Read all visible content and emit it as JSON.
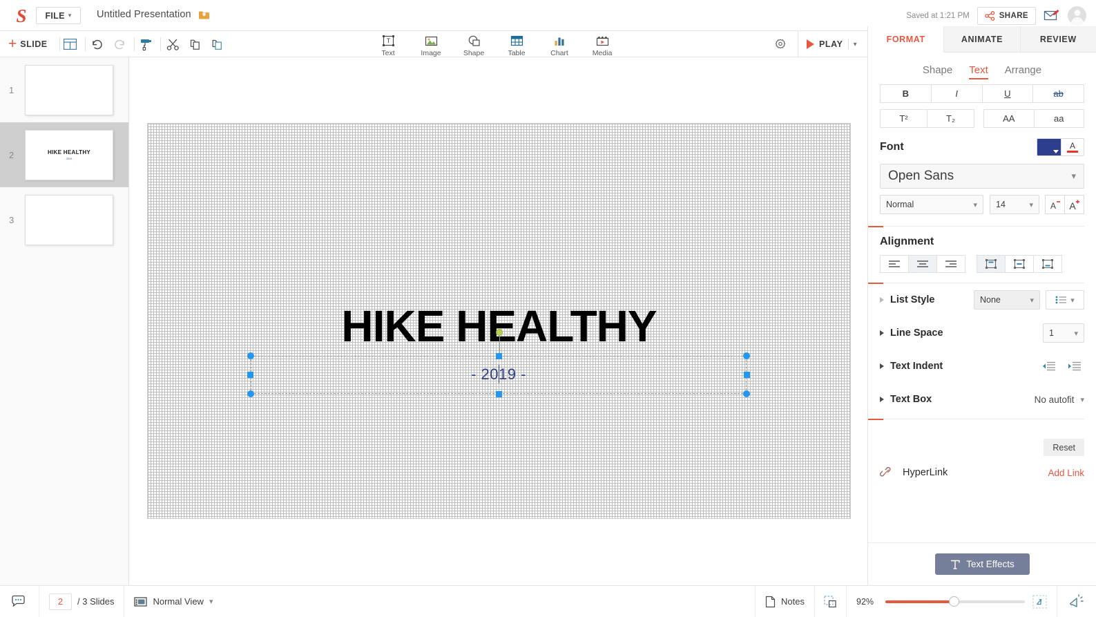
{
  "app": {
    "name": "Zoho Show",
    "logo_icon": "zoho-show-logo"
  },
  "topbar": {
    "file_menu": "FILE",
    "presentation_title": "Untitled Presentation",
    "folder_icon": "folder-move-icon",
    "saved_status": "Saved at 1:21 PM",
    "share_label": "SHARE",
    "share_icon": "share-nodes-icon",
    "mail_icon": "mail-compose-icon",
    "avatar_icon": "user-avatar"
  },
  "toolbar": {
    "add_slide": "SLIDE",
    "plus_icon": "plus-icon",
    "layout_icon": "slide-layout-icon",
    "undo_icon": "undo-icon",
    "redo_icon": "redo-icon",
    "format_painter_icon": "format-painter-icon",
    "cut_icon": "scissors-icon",
    "copy_icon": "copy-icon",
    "paste_icon": "paste-icon",
    "insert": [
      {
        "label": "Text",
        "icon": "text-box-icon"
      },
      {
        "label": "Image",
        "icon": "image-icon"
      },
      {
        "label": "Shape",
        "icon": "shape-icon"
      },
      {
        "label": "Table",
        "icon": "table-icon"
      },
      {
        "label": "Chart",
        "icon": "bar-chart-icon"
      },
      {
        "label": "Media",
        "icon": "media-clapperboard-icon"
      }
    ],
    "settings_icon": "gear-icon",
    "play_label": "PLAY",
    "play_icon": "play-triangle-icon",
    "play_dropdown_icon": "chevron-down-icon"
  },
  "right_tabs": [
    {
      "label": "FORMAT",
      "active": true
    },
    {
      "label": "ANIMATE",
      "active": false
    },
    {
      "label": "REVIEW",
      "active": false
    }
  ],
  "slides_panel": {
    "slides": [
      {
        "number": "1",
        "title": "",
        "subtitle": "",
        "selected": false
      },
      {
        "number": "2",
        "title": "HIKE HEALTHY",
        "subtitle": "- 2019 -",
        "selected": true
      },
      {
        "number": "3",
        "title": "",
        "subtitle": "",
        "selected": false
      }
    ]
  },
  "canvas": {
    "title_text": "HIKE HEALTHY",
    "subtitle_text": "- 2019 -",
    "subtitle_color": "#2e3e8f",
    "title_color": "#000000",
    "selection": "subtitle-text-box"
  },
  "format_panel": {
    "sub_tabs": [
      {
        "label": "Shape",
        "active": false
      },
      {
        "label": "Text",
        "active": true
      },
      {
        "label": "Arrange",
        "active": false
      }
    ],
    "style_buttons": [
      {
        "label": "B",
        "name": "bold-button",
        "selected": false
      },
      {
        "label": "I",
        "name": "italic-button",
        "selected": false
      },
      {
        "label": "U",
        "name": "underline-button",
        "selected": false
      },
      {
        "label": "ab",
        "name": "strikethrough-button",
        "selected": false
      }
    ],
    "script_buttons": [
      {
        "label": "T²",
        "name": "superscript-button"
      },
      {
        "label": "T₂",
        "name": "subscript-button"
      }
    ],
    "case_buttons": [
      {
        "label": "AA",
        "name": "uppercase-button"
      },
      {
        "label": "aa",
        "name": "lowercase-button"
      }
    ],
    "font_section_label": "Font",
    "highlight_color": "#2e3e8f",
    "text_color": "#e8342a",
    "font_family": "Open Sans",
    "font_weight": "Normal",
    "font_size": "14",
    "decrease_size_label": "A",
    "increase_size_label": "A",
    "alignment_label": "Alignment",
    "horizontal_align": [
      {
        "name": "align-left-button",
        "selected": false
      },
      {
        "name": "align-center-button",
        "selected": true
      },
      {
        "name": "align-right-button",
        "selected": false
      }
    ],
    "vertical_align": [
      {
        "name": "align-top-button",
        "selected": true
      },
      {
        "name": "align-middle-button",
        "selected": false
      },
      {
        "name": "align-bottom-button",
        "selected": false
      }
    ],
    "properties": [
      {
        "label": "List Style",
        "value": "None"
      },
      {
        "label": "Line Space",
        "value": "1"
      },
      {
        "label": "Text Indent",
        "value": ""
      },
      {
        "label": "Text Box",
        "value": "No autofit"
      }
    ],
    "reset_label": "Reset",
    "hyperlink_label": "HyperLink",
    "hyperlink_icon": "link-chain-icon",
    "add_link_label": "Add Link",
    "text_effects_label": "Text Effects",
    "text_effects_icon": "text-effects-icon"
  },
  "status_bar": {
    "comments_icon": "comment-bubble-icon",
    "current_slide": "2",
    "slide_count_label": "/ 3 Slides",
    "view_icon": "normal-view-icon",
    "view_label": "Normal View",
    "notes_icon": "notes-page-icon",
    "notes_label": "Notes",
    "fit_icon": "fit-to-screen-icon",
    "zoom_level": "92%",
    "zoom_reset_icon": "zoom-reset-icon",
    "broadcast_icon": "broadcast-megaphone-icon"
  }
}
